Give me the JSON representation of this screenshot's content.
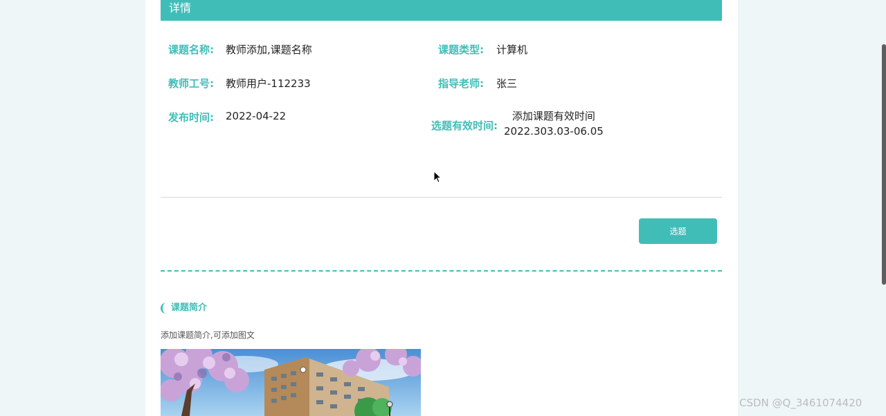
{
  "header": {
    "title": "详情"
  },
  "details": {
    "topic_name_label": "课题名称:",
    "topic_name_value": "教师添加,课题名称",
    "topic_type_label": "课题类型:",
    "topic_type_value": "计算机",
    "teacher_id_label": "教师工号:",
    "teacher_id_value": "教师用户-112233",
    "advisor_label": "指导老师:",
    "advisor_value": "张三",
    "publish_time_label": "发布时间:",
    "publish_time_value": "2022-04-22",
    "valid_time_label": "选题有效时间:",
    "valid_time_line1": "添加课题有效时间",
    "valid_time_line2": "2022.303.03-06.05"
  },
  "actions": {
    "select_label": "选题"
  },
  "intro": {
    "section_title": "课题简介",
    "text": "添加课题简介,可添加图文"
  },
  "watermark": "CSDN @Q_3461074420",
  "colors": {
    "accent": "#41bdb8",
    "background": "#eef6f8"
  }
}
